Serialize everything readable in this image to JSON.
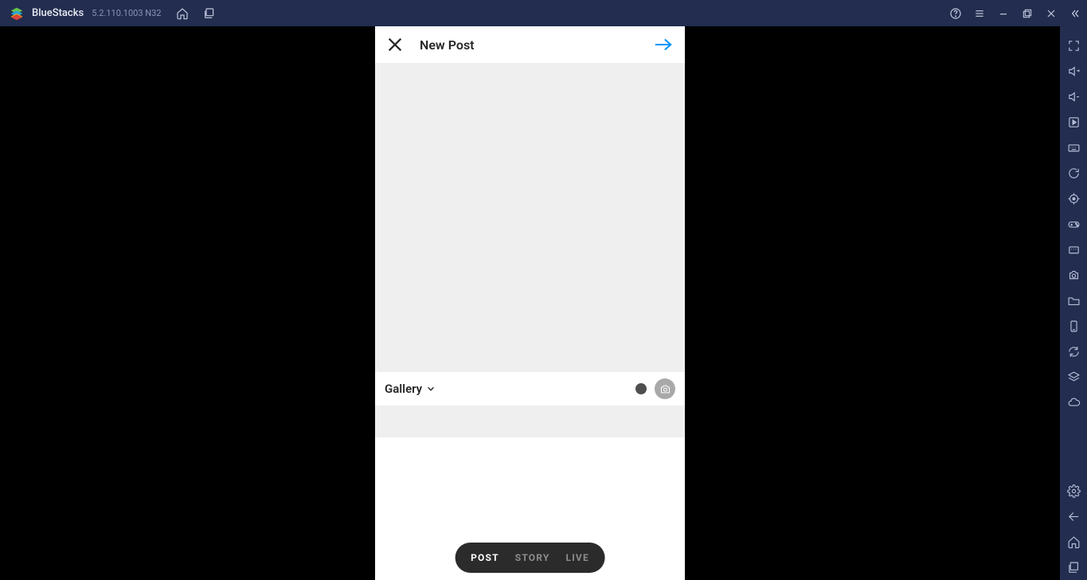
{
  "titlebar": {
    "product_name": "BlueStacks",
    "version": "5.2.110.1003  N32"
  },
  "phone": {
    "title": "New Post",
    "gallery_label": "Gallery",
    "modes": {
      "post": "POST",
      "story": "STORY",
      "live": "LIVE"
    }
  }
}
